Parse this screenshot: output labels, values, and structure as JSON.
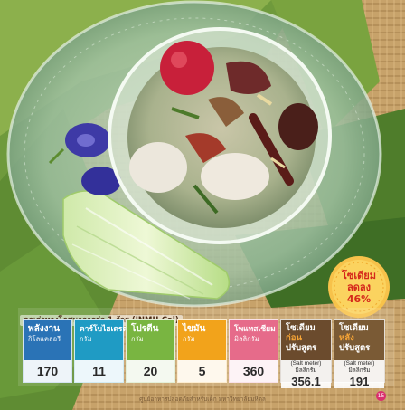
{
  "nutrition": {
    "heading": "คุณค่าทางโภชนาการต่อ 1 ถ้วย (INMU-Cal)",
    "cards": [
      {
        "name": "พลังงาน",
        "unit": "กิโลแคลอรี",
        "value": "170",
        "color": "#2a73b6"
      },
      {
        "name": "คาร์โบไฮเดรต",
        "unit": "กรัม",
        "value": "11",
        "color": "#1f9bc4"
      },
      {
        "name": "โปรตีน",
        "unit": "กรัม",
        "value": "20",
        "color": "#79b541"
      },
      {
        "name": "ไขมัน",
        "unit": "กรัม",
        "value": "5",
        "color": "#f2a31b"
      },
      {
        "name": "โพแทสเซียม",
        "unit": "มิลลิกรัม",
        "value": "360",
        "color": "#e66b8a"
      },
      {
        "name_a": "โซเดียม",
        "name_accent": "ก่อน",
        "name_b": "ปรับสูตร",
        "meter": "(Salt meter)",
        "unit": "มิลลิกรัม",
        "value": "356.1",
        "color": "#6b4b2d"
      },
      {
        "name_a": "โซเดียม",
        "name_accent": "หลัง",
        "name_b": "ปรับสูตร",
        "meter": "(Salt meter)",
        "unit": "มิลลิกรัม",
        "value": "191",
        "color": "#7a5a35"
      }
    ]
  },
  "badge": {
    "line1": "โซเดียม",
    "line2": "ลดลง",
    "line3": "46%",
    "accent": "#d5281b"
  },
  "footer": {
    "text": "ศูนย์อาหารปลอดภัยสำหรับเด็ก มหาวิทยาลัยมหิดล",
    "page": "15"
  }
}
